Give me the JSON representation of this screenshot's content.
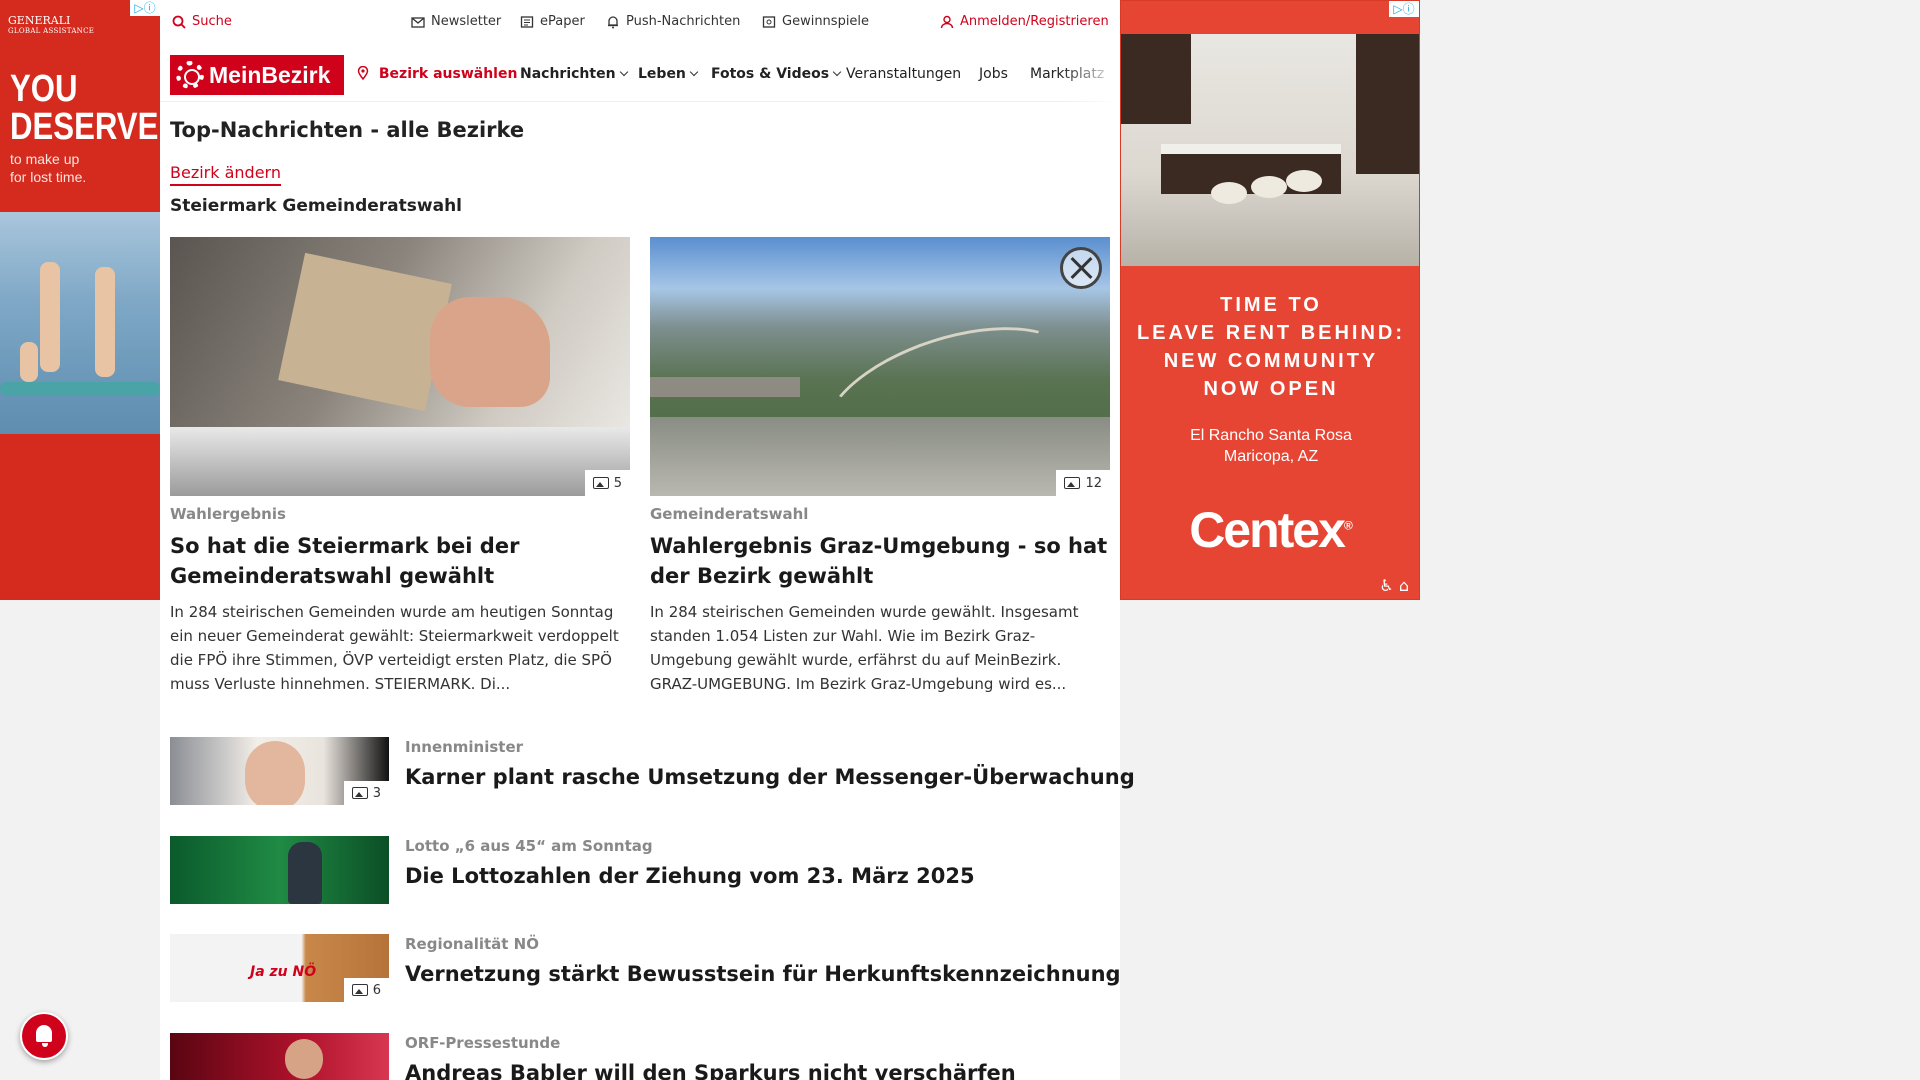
{
  "ads": {
    "left": {
      "brand": "GENERALI",
      "brand_sub": "GLOBAL ASSISTANCE",
      "headline_1": "YOU",
      "headline_2": "DESERVE",
      "sub_1": "to make up",
      "sub_2": "for lost time."
    },
    "right": {
      "line1": "TIME TO",
      "line2": "LEAVE RENT BEHIND:",
      "line3": "NEW COMMUNITY",
      "line4": "NOW OPEN",
      "loc1": "El Rancho Santa Rosa",
      "loc2": "Maricopa, AZ",
      "logo": "Centex",
      "logo_mark": "®"
    }
  },
  "topbar": {
    "search": "Suche",
    "newsletter": "Newsletter",
    "epaper": "ePaper",
    "push": "Push-Nachrichten",
    "gewinnspiele": "Gewinnspiele",
    "login": "Anmelden/Registrieren"
  },
  "nav": {
    "logo": "MeinBezirk",
    "district": "Bezirk auswählen",
    "nachrichten": "Nachrichten",
    "leben": "Leben",
    "fotos": "Fotos & Videos",
    "veranstaltungen": "Veranstaltungen",
    "jobs": "Jobs",
    "marktplatz": "Marktplatz"
  },
  "page": {
    "title": "Top-Nachrichten - alle Bezirke",
    "change_district": "Bezirk ändern",
    "section": "Steiermark Gemeinderatswahl"
  },
  "featured": [
    {
      "category": "Wahlergebnis",
      "title": "So hat die Steiermark bei der Gemeinderatswahl gewählt",
      "teaser": "In 284 steirischen Gemeinden wurde am heutigen Sonntag ein neuer Gemeinderat gewählt: Steiermarkweit verdoppelt die FPÖ ihre Stimmen, ÖVP verteidigt ersten Platz, die SPÖ muss Verluste hinnehmen.  STEIERMARK. Di...",
      "gallery_count": "5"
    },
    {
      "category": "Gemeinderatswahl",
      "title": "Wahlergebnis Graz-Umgebung - so hat der Bezirk gewählt",
      "teaser": "In 284 steirischen Gemeinden wurde gewählt. Insgesamt standen 1.054 Listen zur Wahl. Wie im Bezirk Graz-Umgebung gewählt wurde, erfährst du auf MeinBezirk. GRAZ-UMGEBUNG. Im Bezirk Graz-Umgebung wird es...",
      "gallery_count": "12"
    }
  ],
  "list": [
    {
      "category": "Innenminister",
      "title": "Karner plant rasche Umsetzung der Messenger-Überwachung",
      "gallery_count": "3"
    },
    {
      "category": "Lotto „6 aus 45“ am Sonntag",
      "title": "Die Lottozahlen der Ziehung vom 23. März 2025",
      "gallery_count": ""
    },
    {
      "category": "Regionalität NÖ",
      "title": "Vernetzung stärkt Bewusstsein für Herkunftskennzeichnung",
      "gallery_count": "6"
    },
    {
      "category": "ORF-Pressestunde",
      "title": "Andreas Babler will den Sparkurs nicht verschärfen",
      "gallery_count": ""
    }
  ],
  "colors": {
    "brand": "#d0021b",
    "ad_right": "#e74533",
    "ad_left": "#d52b1e"
  }
}
